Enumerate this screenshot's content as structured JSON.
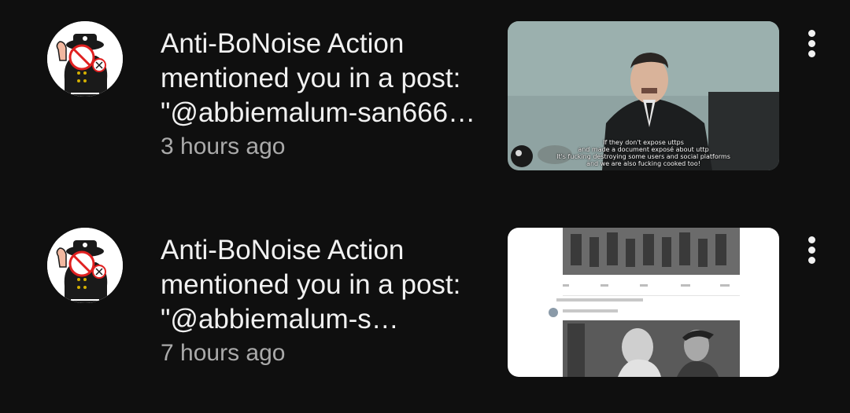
{
  "notifications": [
    {
      "message": "Anti-BoNoise Action mentioned you in a post: \"@abbiemalum-san666…",
      "time": "3 hours ago",
      "thumbnail_caption": [
        "If they don't expose uttps",
        "and made a document exposé about uttp",
        "It's fucking destroying some users and social platforms",
        "and we are also fucking cooked too!"
      ],
      "avatar_icon": "cartoon-officer-avatar-icon",
      "menu_icon": "more-vertical-icon"
    },
    {
      "message": "Anti-BoNoise Action mentioned you in a post: \"@abbiemalum-s…",
      "time": "7 hours ago",
      "avatar_icon": "cartoon-officer-avatar-icon",
      "menu_icon": "more-vertical-icon"
    }
  ],
  "colors": {
    "background": "#0f0f0f",
    "primary_text": "#f1f1f1",
    "secondary_text": "#aaaaaa"
  }
}
